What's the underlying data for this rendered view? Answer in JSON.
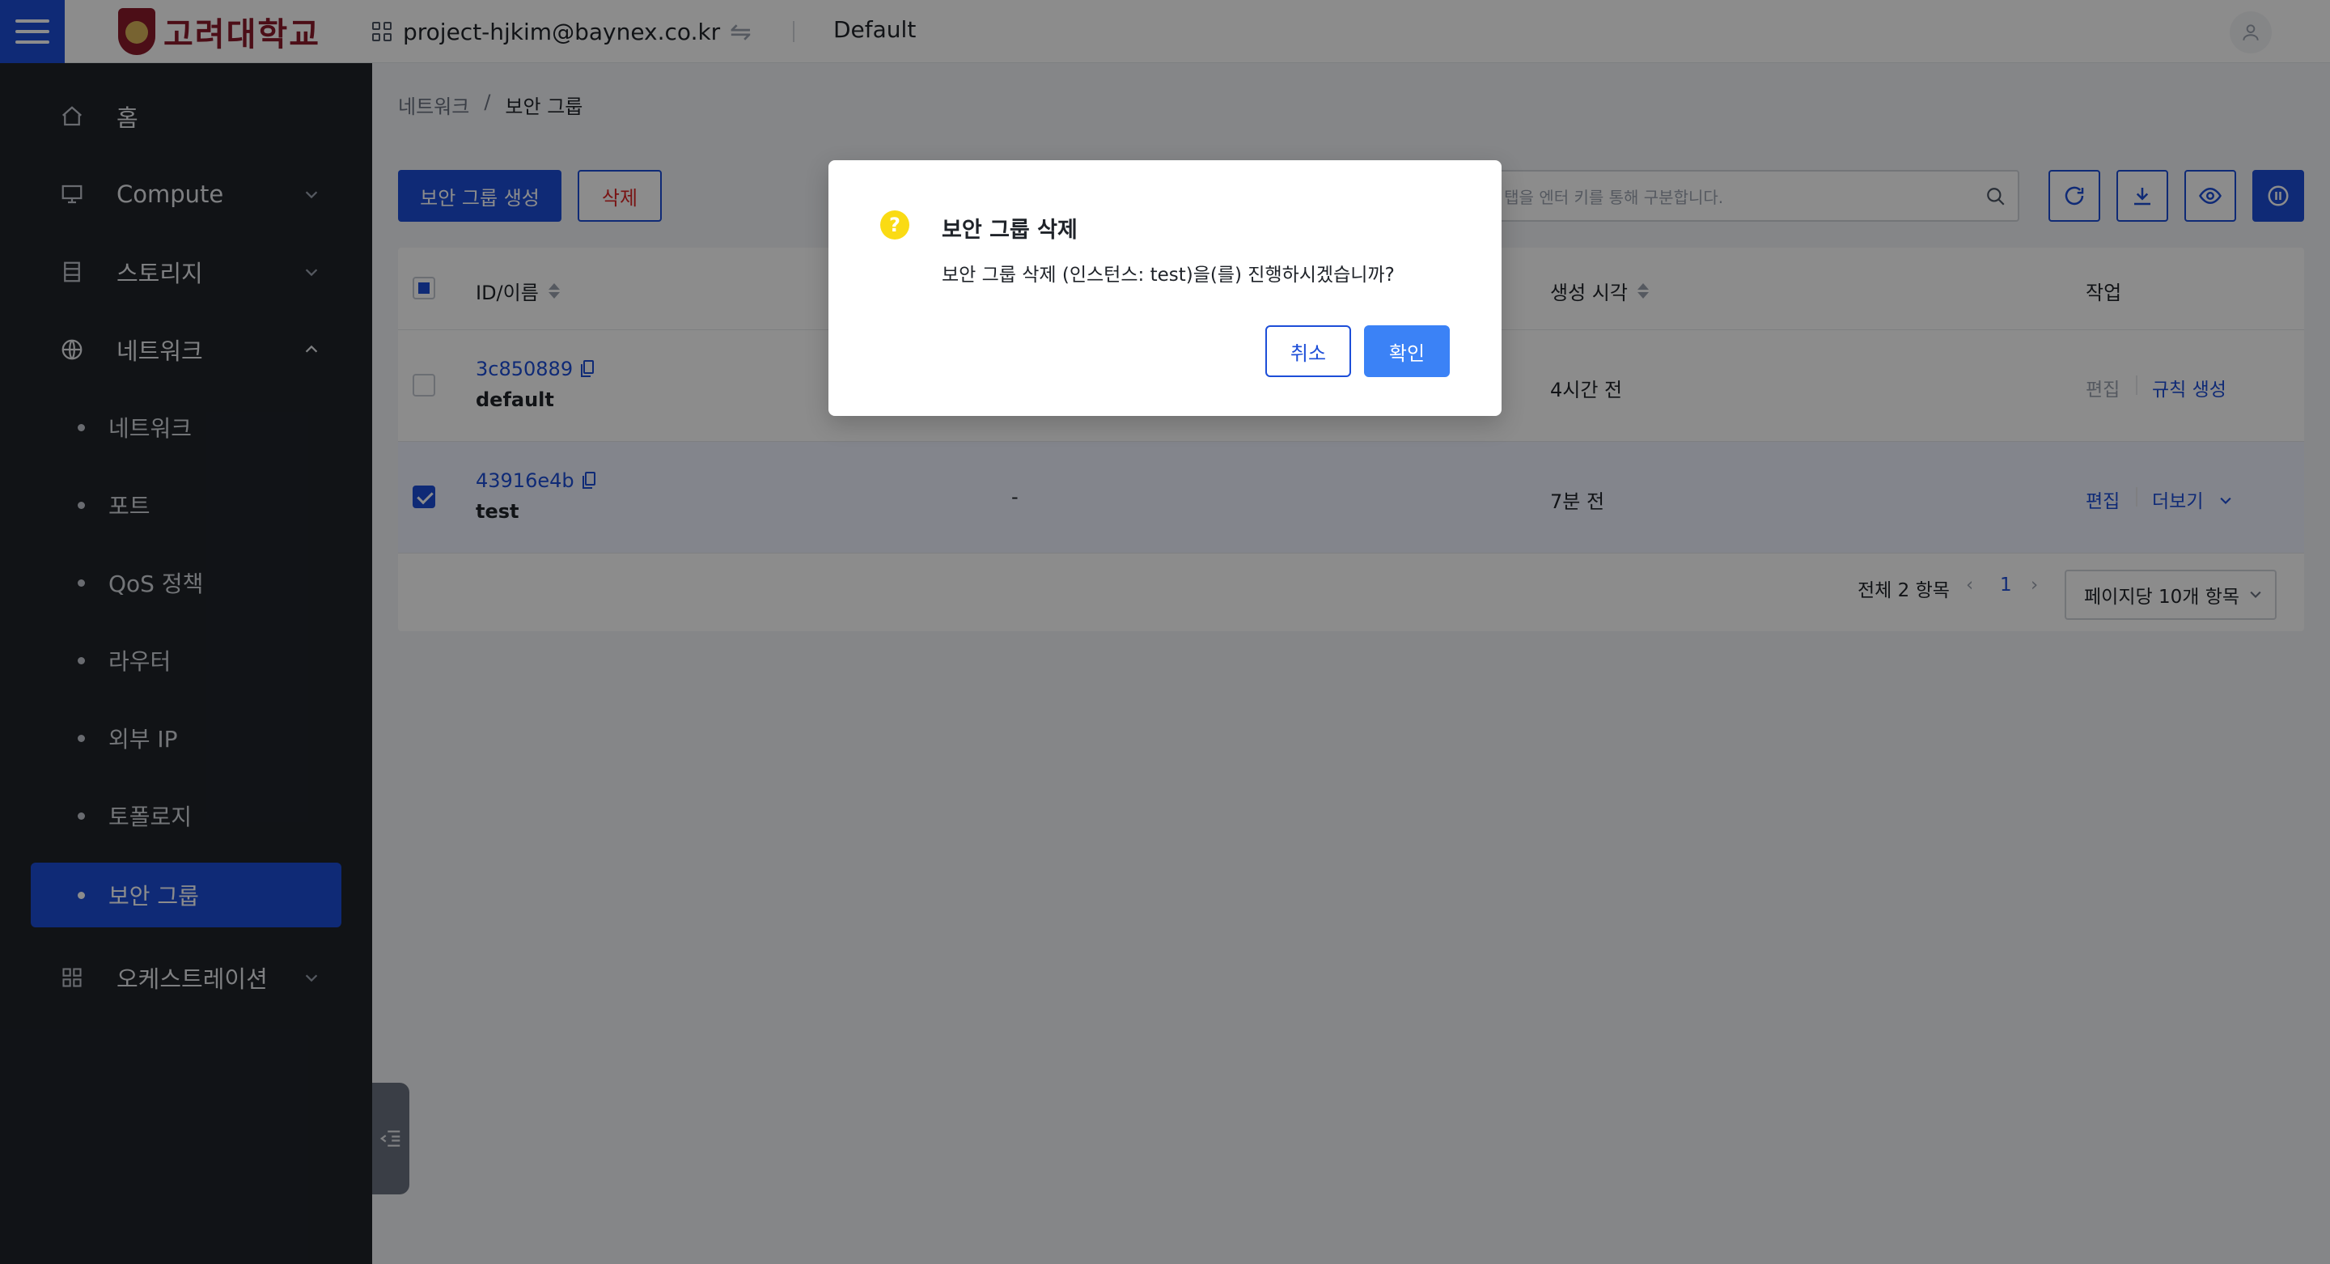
{
  "header": {
    "logo_text": "고려대학교",
    "project": "project-hjkim@baynex.co.kr",
    "domain": "Default"
  },
  "sidebar": {
    "items": [
      {
        "label": "홈",
        "icon": "home-icon"
      },
      {
        "label": "Compute",
        "icon": "monitor-icon"
      },
      {
        "label": "스토리지",
        "icon": "storage-icon"
      },
      {
        "label": "네트워크",
        "icon": "globe-icon"
      },
      {
        "label": "오케스트레이션",
        "icon": "grid-icon"
      }
    ],
    "network_sub": [
      "네트워크",
      "포트",
      "QoS 정책",
      "라우터",
      "외부 IP",
      "토폴로지",
      "보안 그룹"
    ]
  },
  "breadcrumb": {
    "parent": "네트워크",
    "separator": "/",
    "current": "보안 그룹"
  },
  "toolbar": {
    "create_label": "보안 그룹 생성",
    "delete_label": "삭제",
    "search_placeholder": "필터 탭을 엔터 키를 통해 구분합니다."
  },
  "table": {
    "headers": {
      "id_name": "ID/이름",
      "created": "생성 시각",
      "actions": "작업"
    },
    "rows": [
      {
        "id": "3c850889",
        "name": "default",
        "description": "",
        "created": "4시간 전",
        "action1": "편집",
        "action2": "규칙 생성"
      },
      {
        "id": "43916e4b",
        "name": "test",
        "description": "-",
        "created": "7분 전",
        "action1": "편집",
        "action2": "더보기"
      }
    ],
    "pagination": {
      "total": "전체 2 항목",
      "page": "1",
      "page_size": "페이지당 10개 항목"
    }
  },
  "modal": {
    "icon": "?",
    "title": "보안 그룹 삭제",
    "body": "보안 그룹 삭제 (인스턴스: test)을(를) 진행하시겠습니까?",
    "cancel_label": "취소",
    "confirm_label": "확인"
  },
  "colors": {
    "primary": "#1d4ed8",
    "sidebar": "#1f2329",
    "warning": "#fadb14",
    "danger": "#dc2626"
  }
}
